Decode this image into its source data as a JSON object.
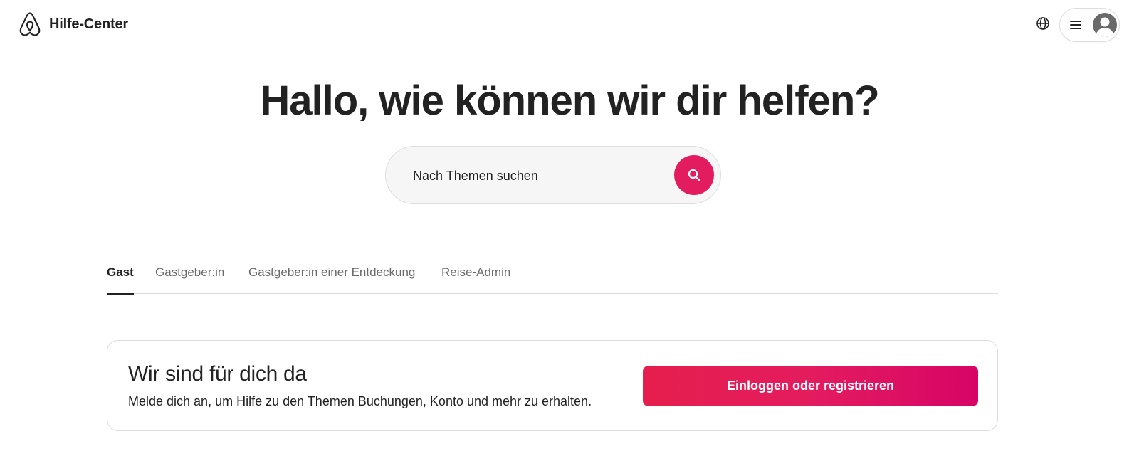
{
  "header": {
    "title": "Hilfe-Center",
    "logo_icon": "airbnb-logo",
    "globe_icon": "globe-icon",
    "menu_icon": "hamburger-menu-icon",
    "avatar_icon": "user-avatar-icon"
  },
  "hero": {
    "title": "Hallo, wie können wir dir helfen?"
  },
  "search": {
    "placeholder": "Nach Themen suchen",
    "icon": "search-icon"
  },
  "tabs": [
    {
      "label": "Gast",
      "active": true
    },
    {
      "label": "Gastgeber:in",
      "active": false
    },
    {
      "label": "Gastgeber:in einer Entdeckung",
      "active": false
    },
    {
      "label": "Reise-Admin",
      "active": false
    }
  ],
  "card": {
    "title": "Wir sind für dich da",
    "text": "Melde dich an, um Hilfe zu den Themen Buchungen, Konto und mehr zu erhalten.",
    "button_label": "Einloggen oder registrieren"
  },
  "colors": {
    "brand": "#E31C5F",
    "text": "#222222",
    "muted": "#6A6A6A",
    "border": "#DDDDDD"
  }
}
